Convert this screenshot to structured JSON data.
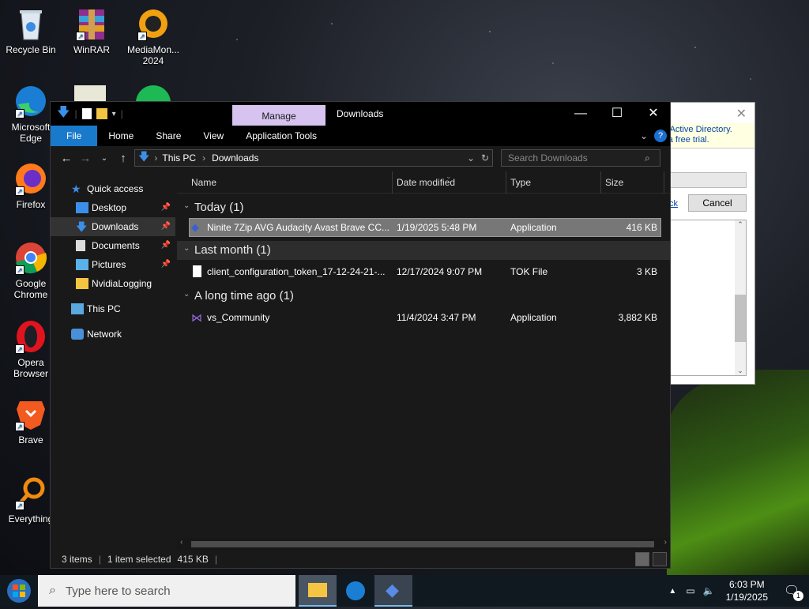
{
  "desktop": {
    "icons": [
      {
        "label": "Recycle Bin"
      },
      {
        "label": "WinRAR"
      },
      {
        "label": "MediaMon... 2024"
      },
      {
        "label": "Microsoft Edge"
      },
      {
        "label": "Firefox"
      },
      {
        "label": "Google Chrome"
      },
      {
        "label": "Opera Browser"
      },
      {
        "label": "Brave"
      },
      {
        "label": "Everything"
      }
    ]
  },
  "background_dialog": {
    "banner_line1": "g Active Directory.",
    "banner_line2": "r a free trial.",
    "link": "ck",
    "cancel": "Cancel"
  },
  "window": {
    "title": "Downloads",
    "manage_tab": "Manage",
    "ribbon_tabs": [
      "File",
      "Home",
      "Share",
      "View",
      "Application Tools"
    ],
    "breadcrumb": [
      "This PC",
      "Downloads"
    ],
    "search_placeholder": "Search Downloads",
    "sidebar": [
      {
        "label": "Quick access",
        "icon": "star-icon"
      },
      {
        "label": "Desktop",
        "icon": "desktop-icon",
        "pinned": true
      },
      {
        "label": "Downloads",
        "icon": "download-icon",
        "pinned": true,
        "selected": true
      },
      {
        "label": "Documents",
        "icon": "documents-icon",
        "pinned": true
      },
      {
        "label": "Pictures",
        "icon": "pictures-icon",
        "pinned": true
      },
      {
        "label": "NvidiaLogging",
        "icon": "folder-icon"
      },
      {
        "label": "This PC",
        "icon": "computer-icon"
      },
      {
        "label": "Network",
        "icon": "network-icon"
      }
    ],
    "columns": [
      "Name",
      "Date modified",
      "Type",
      "Size"
    ],
    "groups": [
      {
        "label": "Today (1)",
        "rows": [
          {
            "name": "Ninite 7Zip AVG Audacity Avast Brave CC...",
            "date": "1/19/2025 5:48 PM",
            "type": "Application",
            "size": "416 KB",
            "selected": true
          }
        ]
      },
      {
        "label": "Last month (1)",
        "rows": [
          {
            "name": "client_configuration_token_17-12-24-21-...",
            "date": "12/17/2024 9:07 PM",
            "type": "TOK File",
            "size": "3 KB"
          }
        ]
      },
      {
        "label": "A long time ago (1)",
        "rows": [
          {
            "name": "vs_Community",
            "date": "11/4/2024 3:47 PM",
            "type": "Application",
            "size": "3,882 KB"
          }
        ]
      }
    ],
    "status": {
      "items": "3 items",
      "selected": "1 item selected",
      "size": "415 KB"
    }
  },
  "taskbar": {
    "search_placeholder": "Type here to search",
    "time": "6:03 PM",
    "date": "1/19/2025",
    "notification_count": "1"
  }
}
